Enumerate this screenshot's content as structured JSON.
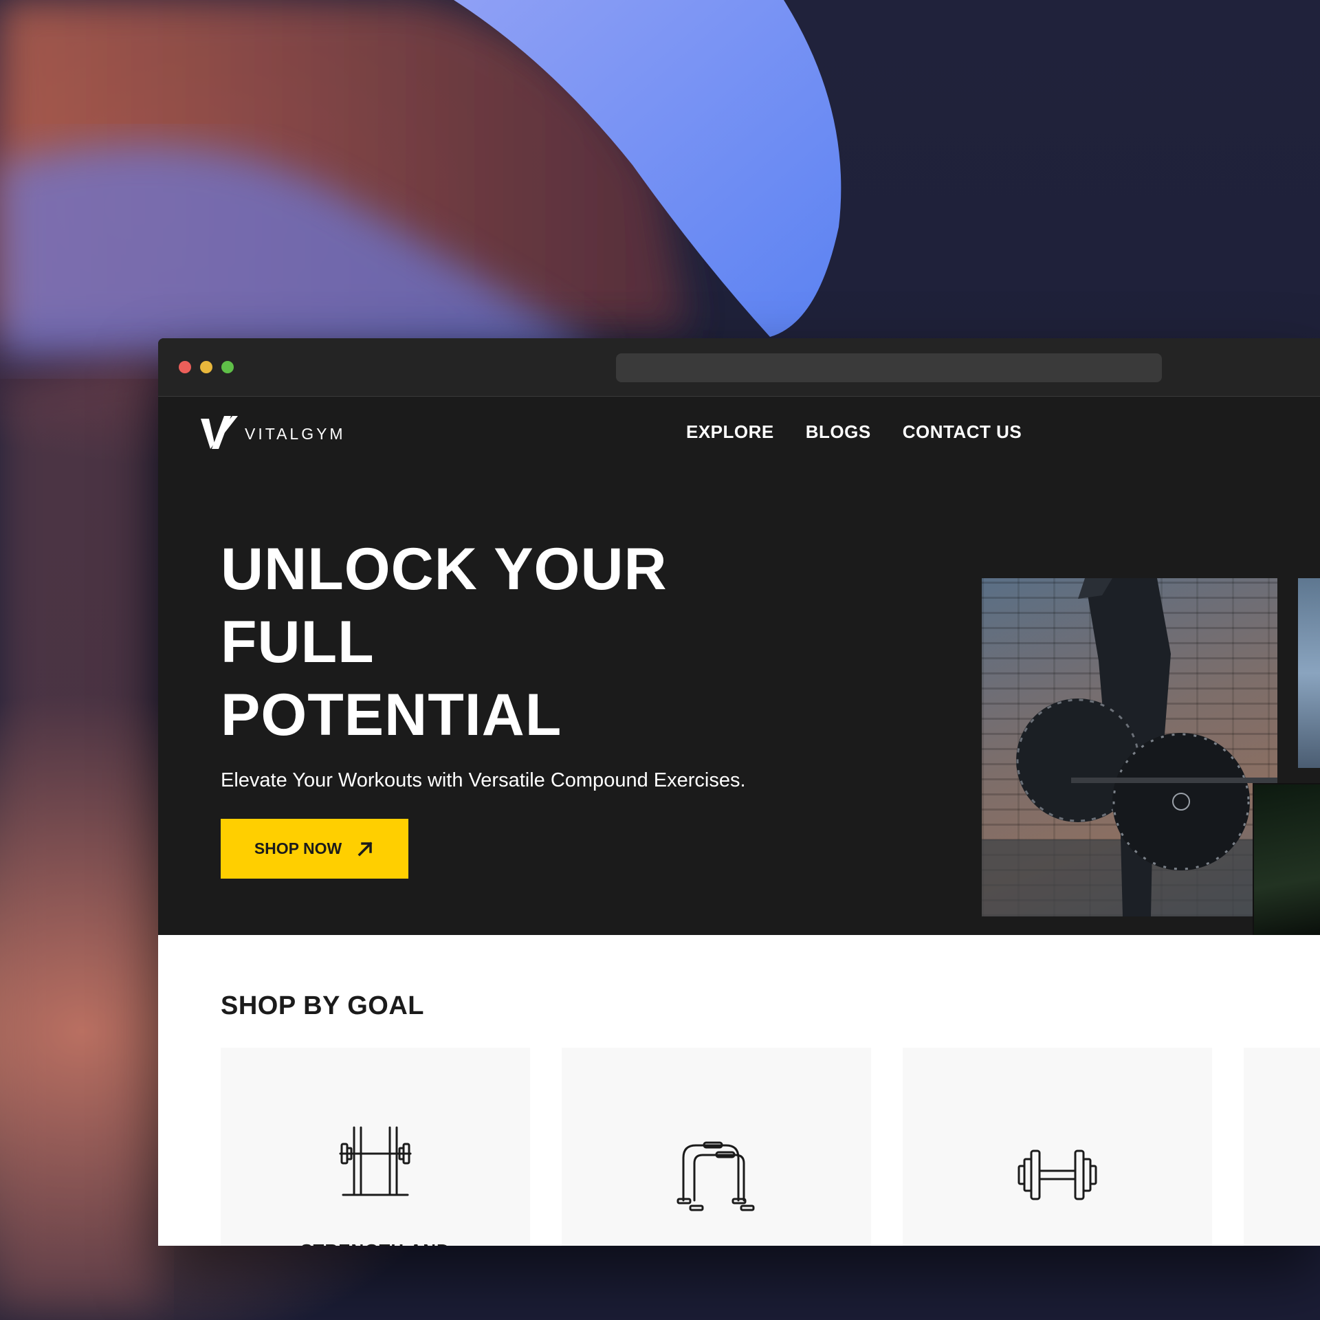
{
  "colors": {
    "accent": "#ffcf00",
    "site_dark": "#1b1b1b",
    "titlebar": "#242424"
  },
  "browser": {
    "address": ""
  },
  "site": {
    "brand": "VITALGYM",
    "nav": [
      "EXPLORE",
      "BLOGS",
      "CONTACT US"
    ]
  },
  "hero": {
    "title_lines": [
      "UNLOCK YOUR",
      "FULL",
      "POTENTIAL"
    ],
    "subtitle": "Elevate Your Workouts with Versatile Compound Exercises.",
    "cta": "SHOP NOW",
    "cta_icon": "arrow-up-right-icon"
  },
  "goals": {
    "title": "SHOP BY GOAL",
    "cards": [
      {
        "icon": "squat-rack-icon",
        "label": "STRENGTH AND"
      },
      {
        "icon": "parallettes-icon",
        "label": ""
      },
      {
        "icon": "dumbbell-icon",
        "label": ""
      }
    ]
  }
}
